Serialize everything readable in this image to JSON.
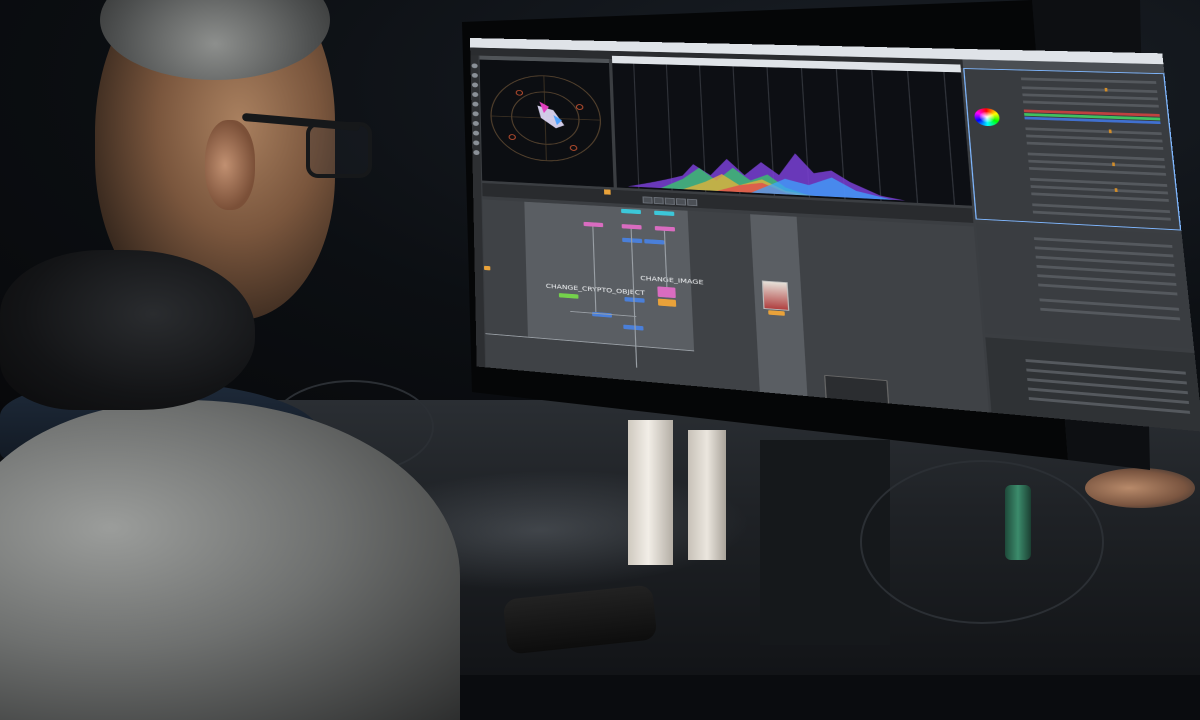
{
  "scene": {
    "description_tags": [
      "person",
      "monitor",
      "desk"
    ]
  },
  "screen": {
    "node_graph": {
      "labels": [
        "CHANGE_CRYPTO_OBJECT",
        "CHANGE_IMAGE"
      ]
    }
  },
  "colors": {
    "accent": "#e9a23a",
    "selection_border": "#7fb7ff",
    "node_pink": "#d96cc0",
    "node_blue": "#4a7fd9",
    "node_green": "#74d14b",
    "node_cyan": "#3cc7d9"
  },
  "icons": [
    "color-wheel-icon",
    "play-icon",
    "stop-icon",
    "tool-icon"
  ]
}
